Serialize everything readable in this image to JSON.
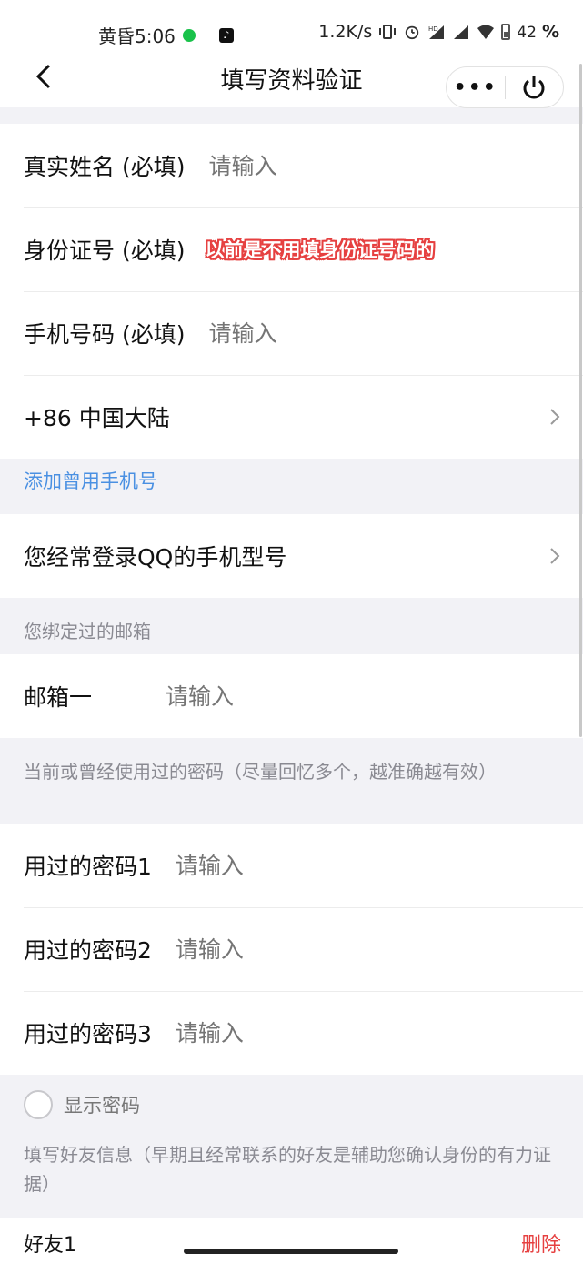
{
  "status_bar": {
    "time": "黄昏5:06",
    "net_speed": "1.2K/s",
    "battery": "42",
    "battery_unit": "%",
    "hd_label": "HD"
  },
  "nav": {
    "title": "填写资料验证",
    "more_label": "•••"
  },
  "identity": {
    "real_name_label": "真实姓名 (必填)",
    "real_name_placeholder": "请输入",
    "id_label": "身份证号 (必填)",
    "id_annotation": "以前是不用填身份证号码的",
    "phone_label": "手机号码 (必填)",
    "phone_placeholder": "请输入",
    "region_label": "+86 中国大陆"
  },
  "add_phone_link": "添加曾用手机号",
  "device_row_label": "您经常登录QQ的手机型号",
  "email_section": {
    "header": "您绑定过的邮箱",
    "email1_label": "邮箱一",
    "email1_placeholder": "请输入"
  },
  "password_section": {
    "header": "当前或曾经使用过的密码（尽量回忆多个，越准确越有效）",
    "items": [
      {
        "label": "用过的密码1",
        "placeholder": "请输入"
      },
      {
        "label": "用过的密码2",
        "placeholder": "请输入"
      },
      {
        "label": "用过的密码3",
        "placeholder": "请输入"
      }
    ],
    "show_password_label": "显示密码"
  },
  "friend_section": {
    "header": "填写好友信息（早期且经常联系的好友是辅助您确认身份的有力证据）",
    "friend1_label": "好友1",
    "delete_label": "删除"
  },
  "colors": {
    "link": "#4a90e2",
    "danger": "#e64040",
    "placeholder": "#b8b8bf",
    "section_bg": "#f2f2f6"
  }
}
